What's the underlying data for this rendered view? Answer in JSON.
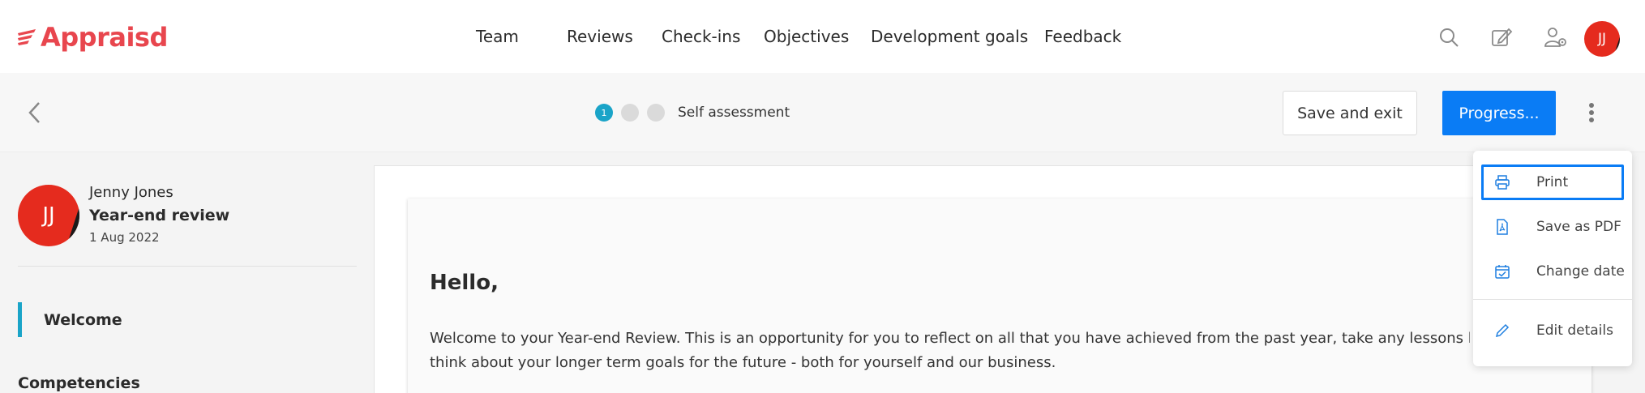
{
  "brand": {
    "name": "Appraisd",
    "color": "#e8464e",
    "logo_icon": "wing-icon"
  },
  "nav": {
    "items": [
      {
        "label": "Team"
      },
      {
        "label": "Reviews"
      },
      {
        "label": "Check-ins"
      },
      {
        "label": "Objectives"
      },
      {
        "label": "Development goals"
      },
      {
        "label": "Feedback"
      }
    ],
    "icons": [
      "search-icon",
      "edit-icon",
      "user-settings-icon"
    ],
    "avatar_initials": "JJ"
  },
  "toolbar": {
    "back_icon": "chevron-left-icon",
    "steps": [
      {
        "label": "1",
        "active": true
      },
      {
        "label": "",
        "active": false
      },
      {
        "label": "",
        "active": false
      }
    ],
    "step_label": "Self assessment",
    "save_exit_label": "Save and exit",
    "progress_label": "Progress...",
    "more_icon": "kebab-icon",
    "accent_color": "#0a7cf5"
  },
  "sidebar": {
    "avatar_initials": "JJ",
    "person_name": "Jenny Jones",
    "review_name": "Year-end review",
    "review_date": "1 Aug 2022",
    "sections": [
      {
        "label": "Welcome",
        "active": true
      },
      {
        "label": "Competencies",
        "active": false
      }
    ]
  },
  "main": {
    "greeting": "Hello,",
    "intro": "Welcome to your Year-end Review.  This is an opportunity for you to reflect on all that you have achieved from the past year, take any lessons learned and to think about your longer term goals for the future - both for yourself and our business."
  },
  "menu": {
    "items": [
      {
        "label": "Print",
        "icon": "printer-icon"
      },
      {
        "label": "Save as PDF",
        "icon": "pdf-icon"
      },
      {
        "label": "Change date",
        "icon": "calendar-icon"
      },
      {
        "label": "Edit details",
        "icon": "pencil-icon"
      }
    ]
  }
}
